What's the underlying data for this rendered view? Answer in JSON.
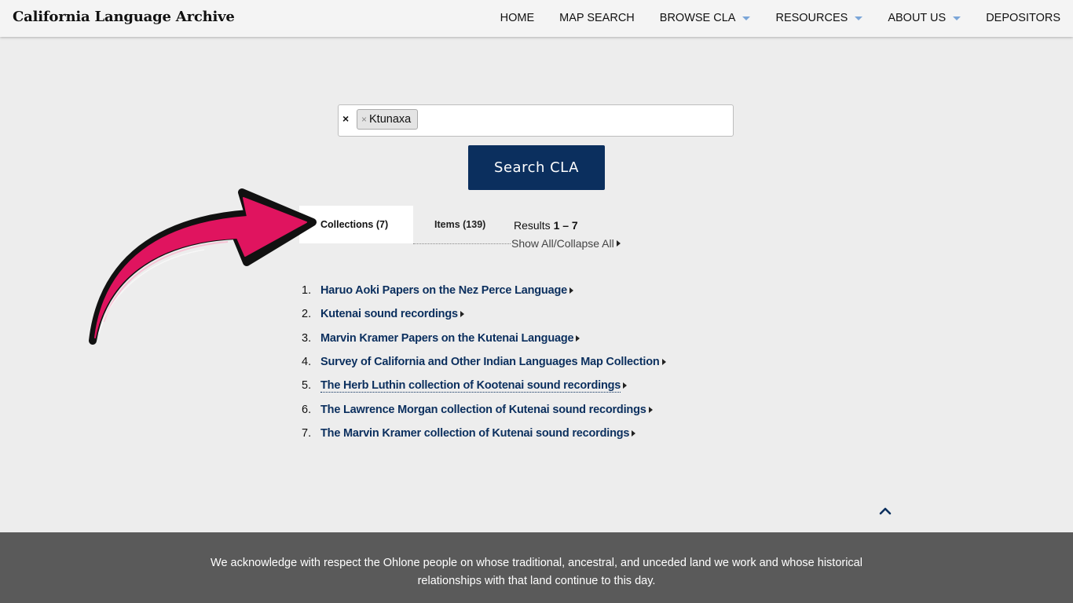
{
  "header": {
    "title": "California Language Archive",
    "nav": [
      {
        "label": "HOME",
        "dropdown": false
      },
      {
        "label": "MAP SEARCH",
        "dropdown": false
      },
      {
        "label": "BROWSE CLA",
        "dropdown": true
      },
      {
        "label": "RESOURCES",
        "dropdown": true
      },
      {
        "label": "ABOUT US",
        "dropdown": true
      },
      {
        "label": "DEPOSITORS",
        "dropdown": false
      }
    ]
  },
  "search": {
    "clear_label": "×",
    "tag_remove": "×",
    "tag_value": "Ktunaxa",
    "button_label": "Search CLA"
  },
  "tabs": {
    "collections": "Collections (7)",
    "items": "Items (139)",
    "results_prefix": "Results ",
    "results_range": "1 – 7",
    "show_all": "Show All/Collapse All"
  },
  "results": [
    {
      "num": "1.",
      "title": "Haruo Aoki Papers on the Nez Perce Language"
    },
    {
      "num": "2.",
      "title": "Kutenai sound recordings"
    },
    {
      "num": "3.",
      "title": "Marvin Kramer Papers on the Kutenai Language"
    },
    {
      "num": "4.",
      "title": "Survey of California and Other Indian Languages Map Collection"
    },
    {
      "num": "5.",
      "title": "The Herb Luthin collection of Kootenai sound recordings"
    },
    {
      "num": "6.",
      "title": "The Lawrence Morgan collection of Kutenai sound recordings"
    },
    {
      "num": "7.",
      "title": "The Marvin Kramer collection of Kutenai sound recordings"
    }
  ],
  "footer": {
    "acknowledgment": "We acknowledge with respect the Ohlone people on whose traditional, ancestral, and unceded land we work and whose historical relationships with that land continue to this day."
  },
  "colors": {
    "brand_navy": "#0b2f5e",
    "annotation_arrow": "#e0145f",
    "footer_bg": "#5a5a5a"
  },
  "icons": {
    "back_to_top": "chevron-up-icon",
    "annotation": "curved-arrow-icon"
  }
}
